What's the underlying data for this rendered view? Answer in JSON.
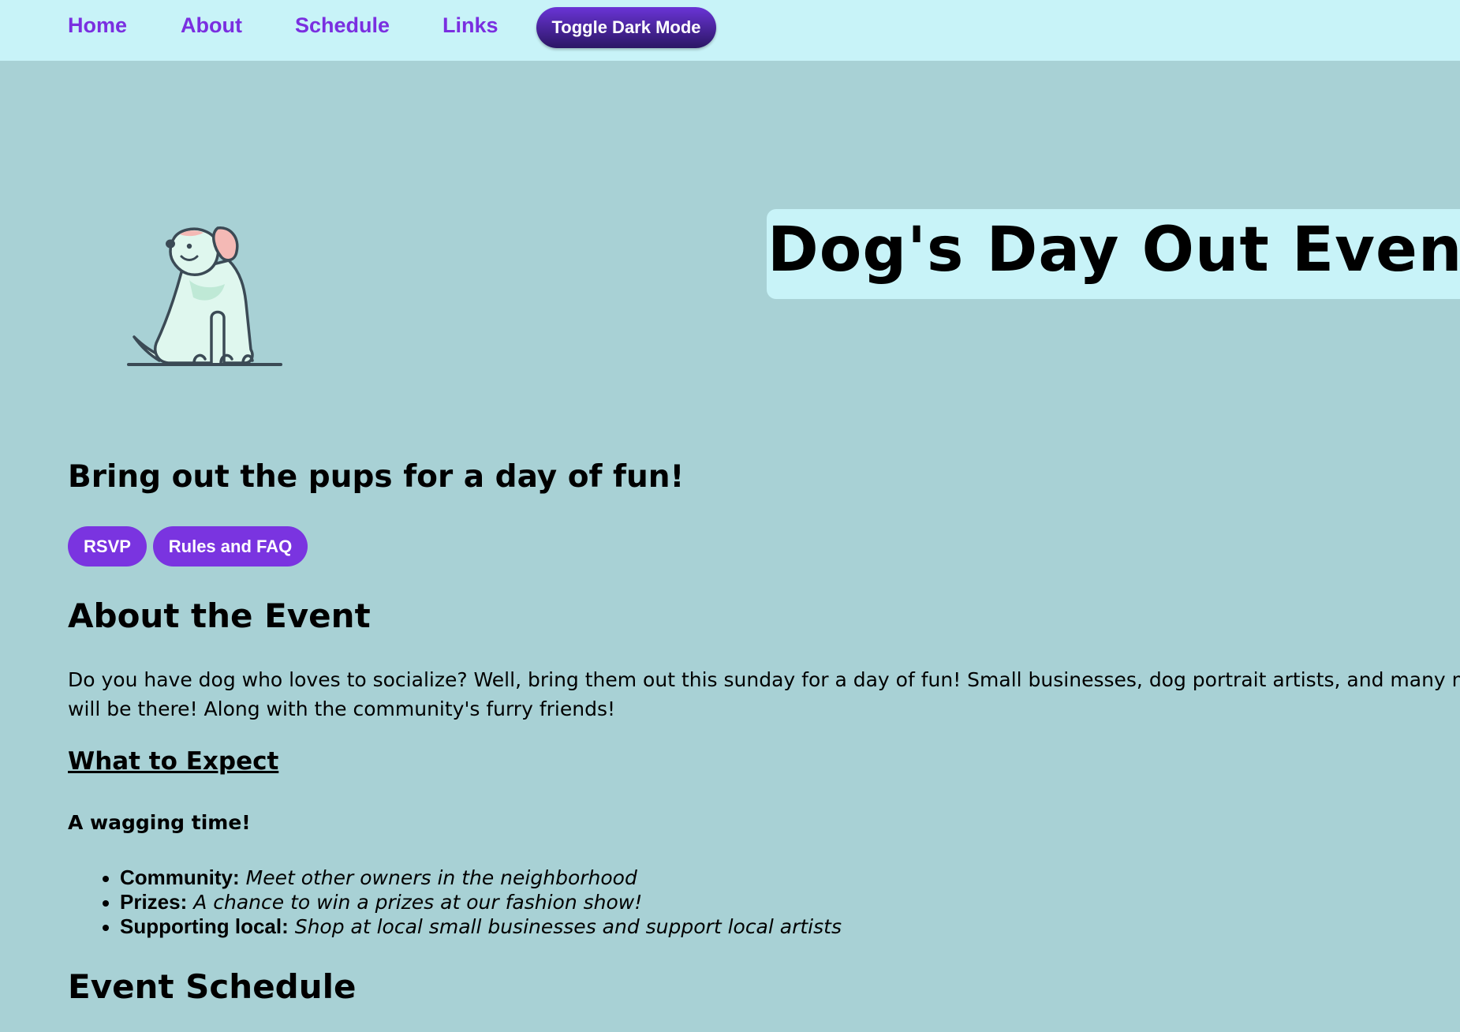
{
  "nav": {
    "links": [
      {
        "label": "Home"
      },
      {
        "label": "About"
      },
      {
        "label": "Schedule"
      },
      {
        "label": "Links"
      }
    ],
    "toggle_label": "Toggle Dark Mode"
  },
  "hero": {
    "title": "Dog's Day Out Event",
    "tagline": "Bring out the pups for a day of fun!",
    "buttons": [
      {
        "label": "RSVP"
      },
      {
        "label": "Rules and FAQ"
      }
    ]
  },
  "about": {
    "heading": "About the Event",
    "paragraph_lines": [
      "Do you have dog who loves to socialize? Well, bring them out this sunday for a day of fun! Small businesses, dog portrait artists, and many more",
      "will be there! Along with the community's furry friends!"
    ]
  },
  "expect": {
    "heading": "What to Expect",
    "subheading": "A wagging time!",
    "items": [
      {
        "label": "Community:",
        "text": "Meet other owners in the neighborhood"
      },
      {
        "label": "Prizes:",
        "text": "A chance to win a prizes at our fashion show!"
      },
      {
        "label": "Supporting local:",
        "text": "Shop at local small businesses and support local artists"
      }
    ]
  },
  "schedule": {
    "heading": "Event Schedule"
  },
  "colors": {
    "background": "#a8d1d5",
    "navbar": "#c8f3f8",
    "accent": "#7a34e0",
    "link": "#7a2fe0"
  }
}
